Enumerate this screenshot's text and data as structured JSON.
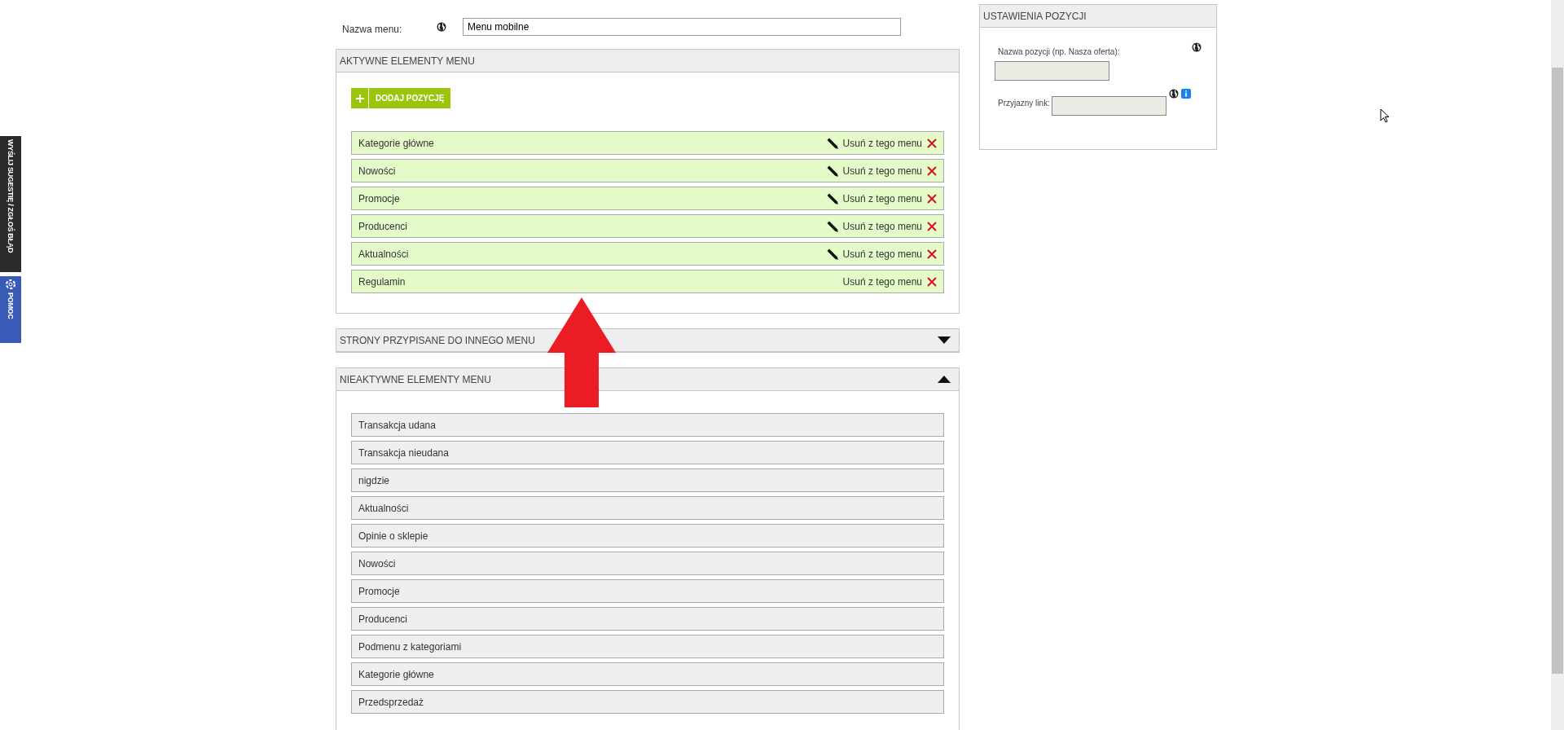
{
  "side_tabs": [
    {
      "label": "WYŚLIJ SUGESTIĘ / ZGŁOŚ BŁĄD",
      "kind": "plain"
    },
    {
      "label": "POMOC",
      "kind": "help"
    }
  ],
  "menu_name": {
    "label": "Nazwa menu:",
    "value": "Menu mobilne"
  },
  "active_panel": {
    "title": "AKTYWNE ELEMENTY MENU",
    "add_button": "DODAJ POZYCJĘ",
    "items": [
      {
        "label": "Kategorie główne",
        "editable": true,
        "remove": "Usuń z tego menu"
      },
      {
        "label": "Nowości",
        "editable": true,
        "remove": "Usuń z tego menu"
      },
      {
        "label": "Promocje",
        "editable": true,
        "remove": "Usuń z tego menu"
      },
      {
        "label": "Producenci",
        "editable": true,
        "remove": "Usuń z tego menu"
      },
      {
        "label": "Aktualności",
        "editable": true,
        "remove": "Usuń z tego menu"
      },
      {
        "label": "Regulamin",
        "editable": false,
        "remove": "Usuń z tego menu"
      }
    ]
  },
  "sections": [
    {
      "title": "STRONY PRZYPISANE DO INNEGO MENU",
      "expanded": false
    },
    {
      "title": "NIEAKTYWNE ELEMENTY MENU",
      "expanded": true,
      "items": [
        "Transakcja udana",
        "Transakcja nieudana",
        "nigdzie",
        "Aktualności",
        "Opinie o sklepie",
        "Nowości",
        "Promocje",
        "Producenci",
        "Podmenu z kategoriami",
        "Kategorie główne",
        "Przedsprzedaż"
      ]
    }
  ],
  "settings": {
    "title": "USTAWIENIA POZYCJI",
    "name_label": "Nazwa pozycji (np. Nasza oferta):",
    "link_label": "Przyjazny link:"
  }
}
